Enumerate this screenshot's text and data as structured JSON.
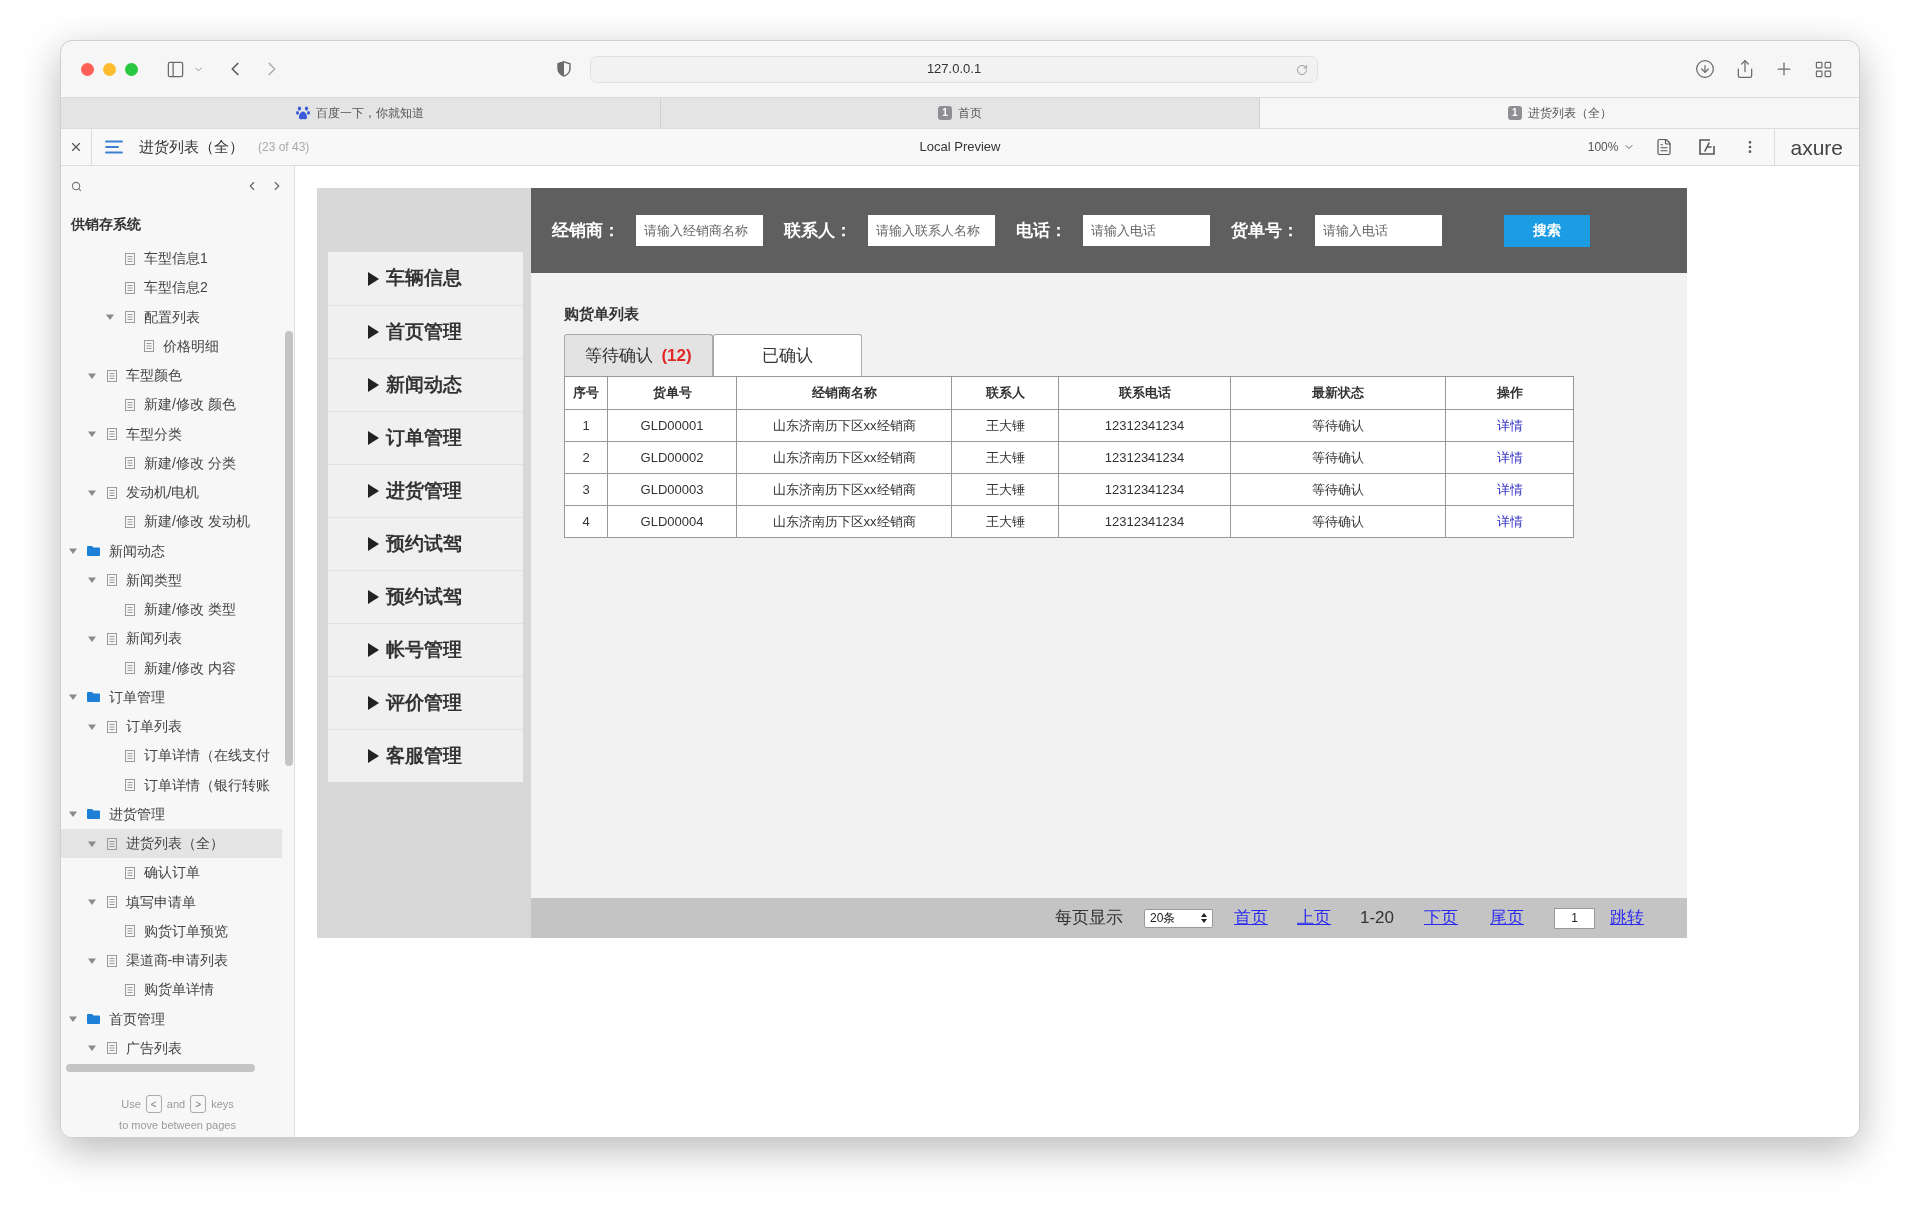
{
  "browser": {
    "url": "127.0.0.1",
    "tabs": [
      {
        "kind": "baidu",
        "title": "百度一下，你就知道",
        "selected": false
      },
      {
        "kind": "page",
        "badge": "1",
        "title": "首页",
        "selected": false
      },
      {
        "kind": "page",
        "badge": "1",
        "title": "进货列表（全）",
        "selected": true
      }
    ]
  },
  "toolbar": {
    "page_title": "进货列表（全）",
    "page_count": "(23 of 43)",
    "mode": "Local Preview",
    "zoom": "100%",
    "logo": "axure"
  },
  "sidebar": {
    "title": "供销存系统",
    "tree": [
      {
        "children": [
          {
            "children": [
              {
                "label": "车型信息1",
                "kind": "page",
                "selected": false
              },
              {
                "label": "车型信息2",
                "kind": "page",
                "selected": false
              },
              {
                "label": "配置列表",
                "kind": "page",
                "selected": false,
                "expanded": true,
                "children": [
                  {
                    "label": "价格明细",
                    "kind": "page",
                    "selected": false
                  }
                ]
              }
            ]
          },
          {
            "label": "车型颜色",
            "kind": "page",
            "selected": false,
            "expanded": true,
            "children": [
              {
                "label": "新建/修改 颜色",
                "kind": "page",
                "selected": false
              }
            ]
          },
          {
            "label": "车型分类",
            "kind": "page",
            "selected": false,
            "expanded": true,
            "children": [
              {
                "label": "新建/修改 分类",
                "kind": "page",
                "selected": false
              }
            ]
          },
          {
            "label": "发动机/电机",
            "kind": "page",
            "selected": false,
            "expanded": true,
            "children": [
              {
                "label": "新建/修改 发动机",
                "kind": "page",
                "selected": false
              }
            ]
          }
        ]
      },
      {
        "label": "新闻动态",
        "kind": "folder",
        "selected": false,
        "expanded": true,
        "children": [
          {
            "label": "新闻类型",
            "kind": "page",
            "selected": false,
            "expanded": true,
            "children": [
              {
                "label": "新建/修改 类型",
                "kind": "page",
                "selected": false
              }
            ]
          },
          {
            "label": "新闻列表",
            "kind": "page",
            "selected": false,
            "expanded": true,
            "children": [
              {
                "label": "新建/修改 内容",
                "kind": "page",
                "selected": false
              }
            ]
          }
        ]
      },
      {
        "label": "订单管理",
        "kind": "folder",
        "selected": false,
        "expanded": true,
        "children": [
          {
            "label": "订单列表",
            "kind": "page",
            "selected": false,
            "expanded": true,
            "children": [
              {
                "label": "订单详情（在线支付",
                "kind": "page",
                "selected": false
              },
              {
                "label": "订单详情（银行转账",
                "kind": "page",
                "selected": false
              }
            ]
          }
        ]
      },
      {
        "label": "进货管理",
        "kind": "folder",
        "selected": false,
        "expanded": true,
        "children": [
          {
            "label": "进货列表（全）",
            "kind": "page",
            "selected": true,
            "expanded": true,
            "children": [
              {
                "label": "确认订单",
                "kind": "page",
                "selected": false
              }
            ]
          },
          {
            "label": "填写申请单",
            "kind": "page",
            "selected": false,
            "expanded": true,
            "children": [
              {
                "label": "购货订单预览",
                "kind": "page",
                "selected": false
              }
            ]
          },
          {
            "label": "渠道商-申请列表",
            "kind": "page",
            "selected": false,
            "expanded": true,
            "children": [
              {
                "label": "购货单详情",
                "kind": "page",
                "selected": false
              }
            ]
          }
        ]
      },
      {
        "label": "首页管理",
        "kind": "folder",
        "selected": false,
        "expanded": true,
        "children": [
          {
            "label": "广告列表",
            "kind": "page",
            "selected": false,
            "expanded": true
          }
        ]
      }
    ],
    "footer": {
      "words": [
        "Use",
        "and",
        "keys"
      ],
      "keys": [
        "<",
        ">"
      ],
      "line_2": "to move between pages"
    }
  },
  "prototype": {
    "menu": [
      "车辆信息",
      "首页管理",
      "新闻动态",
      "订单管理",
      "进货管理",
      "预约试驾",
      "预约试驾",
      "帐号管理",
      "评价管理",
      "客服管理"
    ],
    "search": {
      "fields": [
        {
          "label": "经销商：",
          "placeholder": "请输入经销商名称"
        },
        {
          "label": "联系人：",
          "placeholder": "请输入联系人名称"
        },
        {
          "label": "电话：",
          "placeholder": "请输入电话"
        },
        {
          "label": "货单号：",
          "placeholder": "请输入电话"
        }
      ],
      "button": "搜索"
    },
    "list_title": "购货单列表",
    "tabs": [
      {
        "label": "等待确认",
        "count": "(12)",
        "selected": true
      },
      {
        "label": "已确认",
        "selected": false
      }
    ],
    "table": {
      "columns": [
        "序号",
        "货单号",
        "经销商名称",
        "联系人",
        "联系电话",
        "最新状态",
        "操作"
      ],
      "rows": [
        {
          "cells": [
            "1",
            "GLD00001",
            "山东济南历下区xx经销商",
            "王大锤",
            "12312341234",
            "等待确认"
          ],
          "action": "详情"
        },
        {
          "cells": [
            "2",
            "GLD00002",
            "山东济南历下区xx经销商",
            "王大锤",
            "12312341234",
            "等待确认"
          ],
          "action": "详情"
        },
        {
          "cells": [
            "3",
            "GLD00003",
            "山东济南历下区xx经销商",
            "王大锤",
            "12312341234",
            "等待确认"
          ],
          "action": "详情"
        },
        {
          "cells": [
            "4",
            "GLD00004",
            "山东济南历下区xx经销商",
            "王大锤",
            "12312341234",
            "等待确认"
          ],
          "action": "详情"
        }
      ]
    },
    "pagination": {
      "per_page_label": "每页显示",
      "per_page": "20条",
      "first": "首页",
      "prev": "上页",
      "range": "1-20",
      "next": "下页",
      "last": "尾页",
      "page": "1",
      "go": "跳转"
    }
  }
}
